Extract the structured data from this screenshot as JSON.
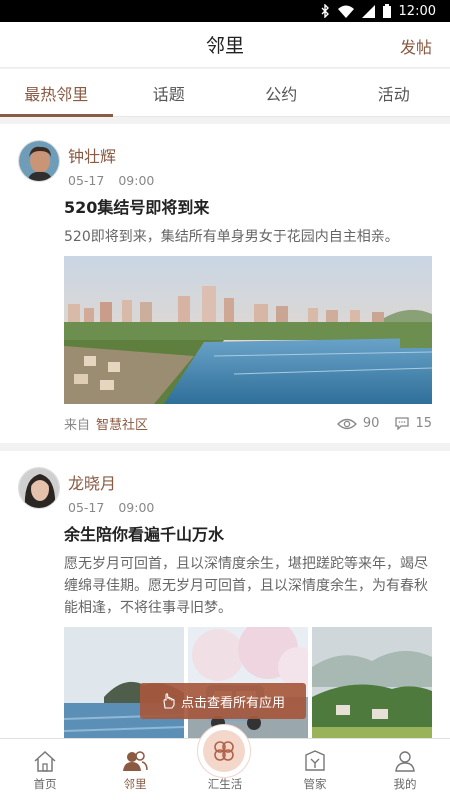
{
  "status_bar": {
    "time": "12:00"
  },
  "header": {
    "title": "邻里",
    "post_label": "发帖"
  },
  "tabs": [
    {
      "label": "最热邻里",
      "active": true
    },
    {
      "label": "话题"
    },
    {
      "label": "公约"
    },
    {
      "label": "活动"
    }
  ],
  "posts": [
    {
      "author": "钟壮辉",
      "date": "05-17",
      "time": "09:00",
      "title": "520集结号即将到来",
      "body": "520即将到来，集结所有单身男女于花园内自主相亲。",
      "source_prefix": "来自",
      "source_name": "智慧社区",
      "views": "90",
      "comments": "15"
    },
    {
      "author": "龙晓月",
      "date": "05-17",
      "time": "09:00",
      "title": "余生陪你看遍千山万水",
      "body": "愿无岁月可回首，且以深情度余生，堪把蹉跎等来年，竭尽缠绵寻佳期。愿无岁月可回首，且以深情度余生，为有春秋能相逢，不将往事寻旧梦。"
    }
  ],
  "toast": {
    "text": "点击查看所有应用"
  },
  "bottom_nav": [
    {
      "label": "首页",
      "icon": "home-icon"
    },
    {
      "label": "邻里",
      "icon": "neighbors-icon",
      "active": true
    },
    {
      "label": "汇生活",
      "icon": "clover-icon"
    },
    {
      "label": "管家",
      "icon": "butler-icon"
    },
    {
      "label": "我的",
      "icon": "user-icon"
    }
  ],
  "colors": {
    "accent": "#8a5a43",
    "toast_bg": "#a6583c"
  }
}
